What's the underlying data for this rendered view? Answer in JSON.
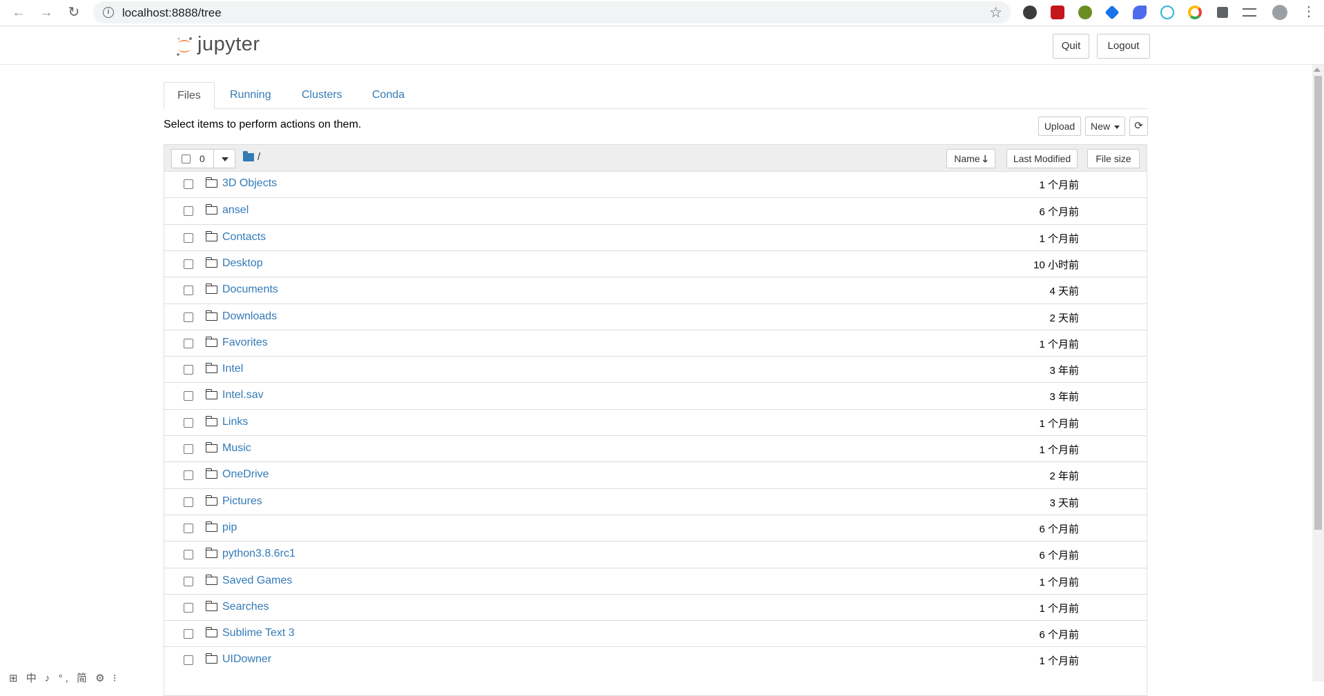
{
  "browser": {
    "url": "localhost:8888/tree"
  },
  "header": {
    "logo_text": "jupyter",
    "quit_label": "Quit",
    "logout_label": "Logout"
  },
  "tabs": [
    {
      "label": "Files",
      "active": true
    },
    {
      "label": "Running"
    },
    {
      "label": "Clusters"
    },
    {
      "label": "Conda"
    }
  ],
  "toolbar": {
    "hint": "Select items to perform actions on them.",
    "upload_label": "Upload",
    "new_label": "New",
    "refresh_icon": "refresh-icon"
  },
  "list_header": {
    "selected_count": "0",
    "breadcrumb": "/",
    "sort_name_label": "Name",
    "sort_modified_label": "Last Modified",
    "sort_size_label": "File size"
  },
  "rows": [
    {
      "name": "3D Objects",
      "modified": "1 个月前"
    },
    {
      "name": "ansel",
      "modified": "6 个月前"
    },
    {
      "name": "Contacts",
      "modified": "1 个月前"
    },
    {
      "name": "Desktop",
      "modified": "10 小时前"
    },
    {
      "name": "Documents",
      "modified": "4 天前"
    },
    {
      "name": "Downloads",
      "modified": "2 天前"
    },
    {
      "name": "Favorites",
      "modified": "1 个月前"
    },
    {
      "name": "Intel",
      "modified": "3 年前"
    },
    {
      "name": "Intel.sav",
      "modified": "3 年前"
    },
    {
      "name": "Links",
      "modified": "1 个月前"
    },
    {
      "name": "Music",
      "modified": "1 个月前"
    },
    {
      "name": "OneDrive",
      "modified": "2 年前"
    },
    {
      "name": "Pictures",
      "modified": "3 天前"
    },
    {
      "name": "pip",
      "modified": "6 个月前"
    },
    {
      "name": "python3.8.6rc1",
      "modified": "6 个月前"
    },
    {
      "name": "Saved Games",
      "modified": "1 个月前"
    },
    {
      "name": "Searches",
      "modified": "1 个月前"
    },
    {
      "name": "Sublime Text 3",
      "modified": "6 个月前"
    },
    {
      "name": "UIDowner",
      "modified": "1 个月前"
    }
  ],
  "ime_bar": "中 ♪ °, 简 ⚙ ⁝",
  "colors": {
    "link": "#337ab7",
    "jupyter_orange": "#f37626"
  }
}
